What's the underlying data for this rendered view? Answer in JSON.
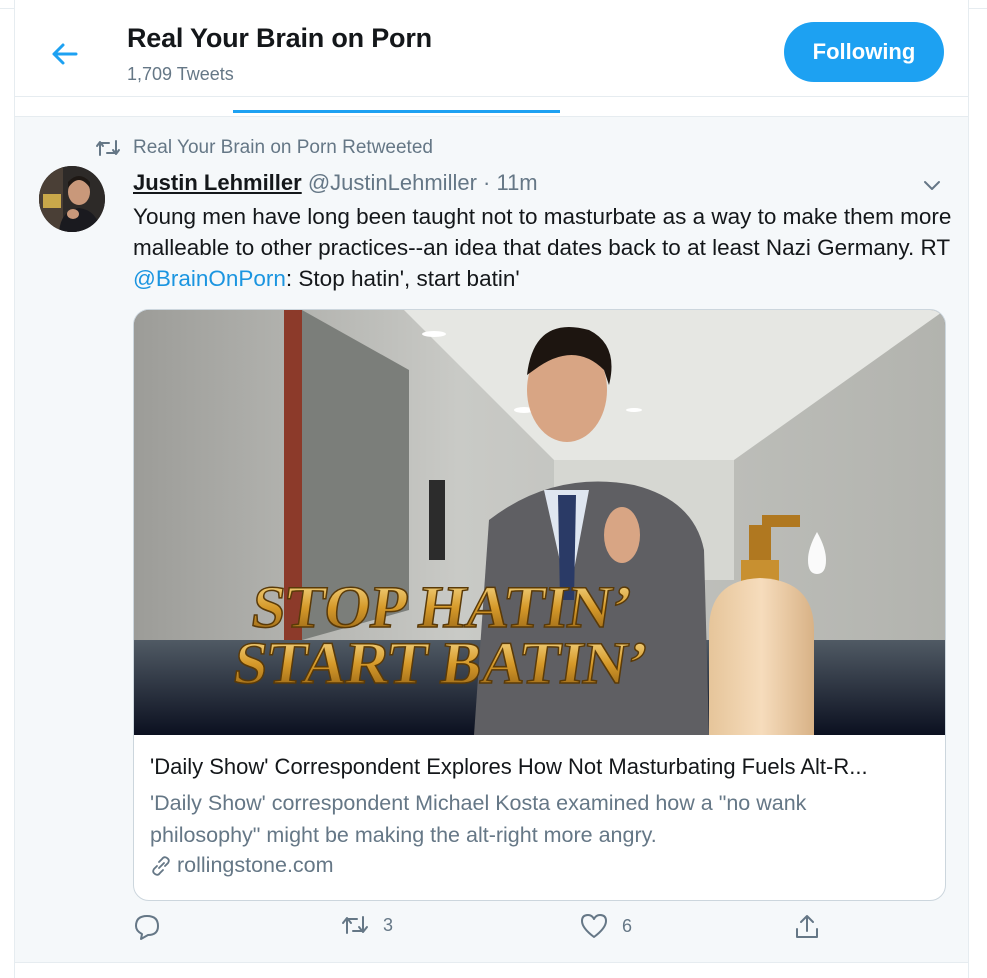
{
  "header": {
    "title": "Real Your Brain on Porn",
    "tweet_count": "1,709 Tweets",
    "follow_label": "Following",
    "back_icon": "arrow-left-icon"
  },
  "colors": {
    "accent": "#1da1f2",
    "mention": "#1b95e0",
    "muted": "#657786",
    "text": "#14171a",
    "card_bg": "#f5f8fa"
  },
  "tweet": {
    "retweet_context": "Real Your Brain on Porn Retweeted",
    "author_name": "Justin Lehmiller",
    "author_handle": "@JustinLehmiller",
    "separator": " · ",
    "time": "11m",
    "text_before_mention": "Young men have long been taught not to masturbate as a way to make them more malleable to other practices--an idea that dates back to at least Nazi Germany. RT ",
    "mention": "@BrainOnPorn",
    "text_after_mention": ": Stop hatin', start batin'",
    "card": {
      "image_caption_line1": "STOP HATIN’",
      "image_caption_line2": "START BATIN’",
      "title": "'Daily Show' Correspondent Explores How Not Masturbating Fuels Alt-R...",
      "description": "'Daily Show' correspondent Michael Kosta examined how a \"no wank philosophy\" might be making the alt-right more angry.",
      "domain": "rollingstone.com"
    },
    "actions": {
      "reply_count": "",
      "retweet_count": "3",
      "like_count": "6"
    }
  }
}
